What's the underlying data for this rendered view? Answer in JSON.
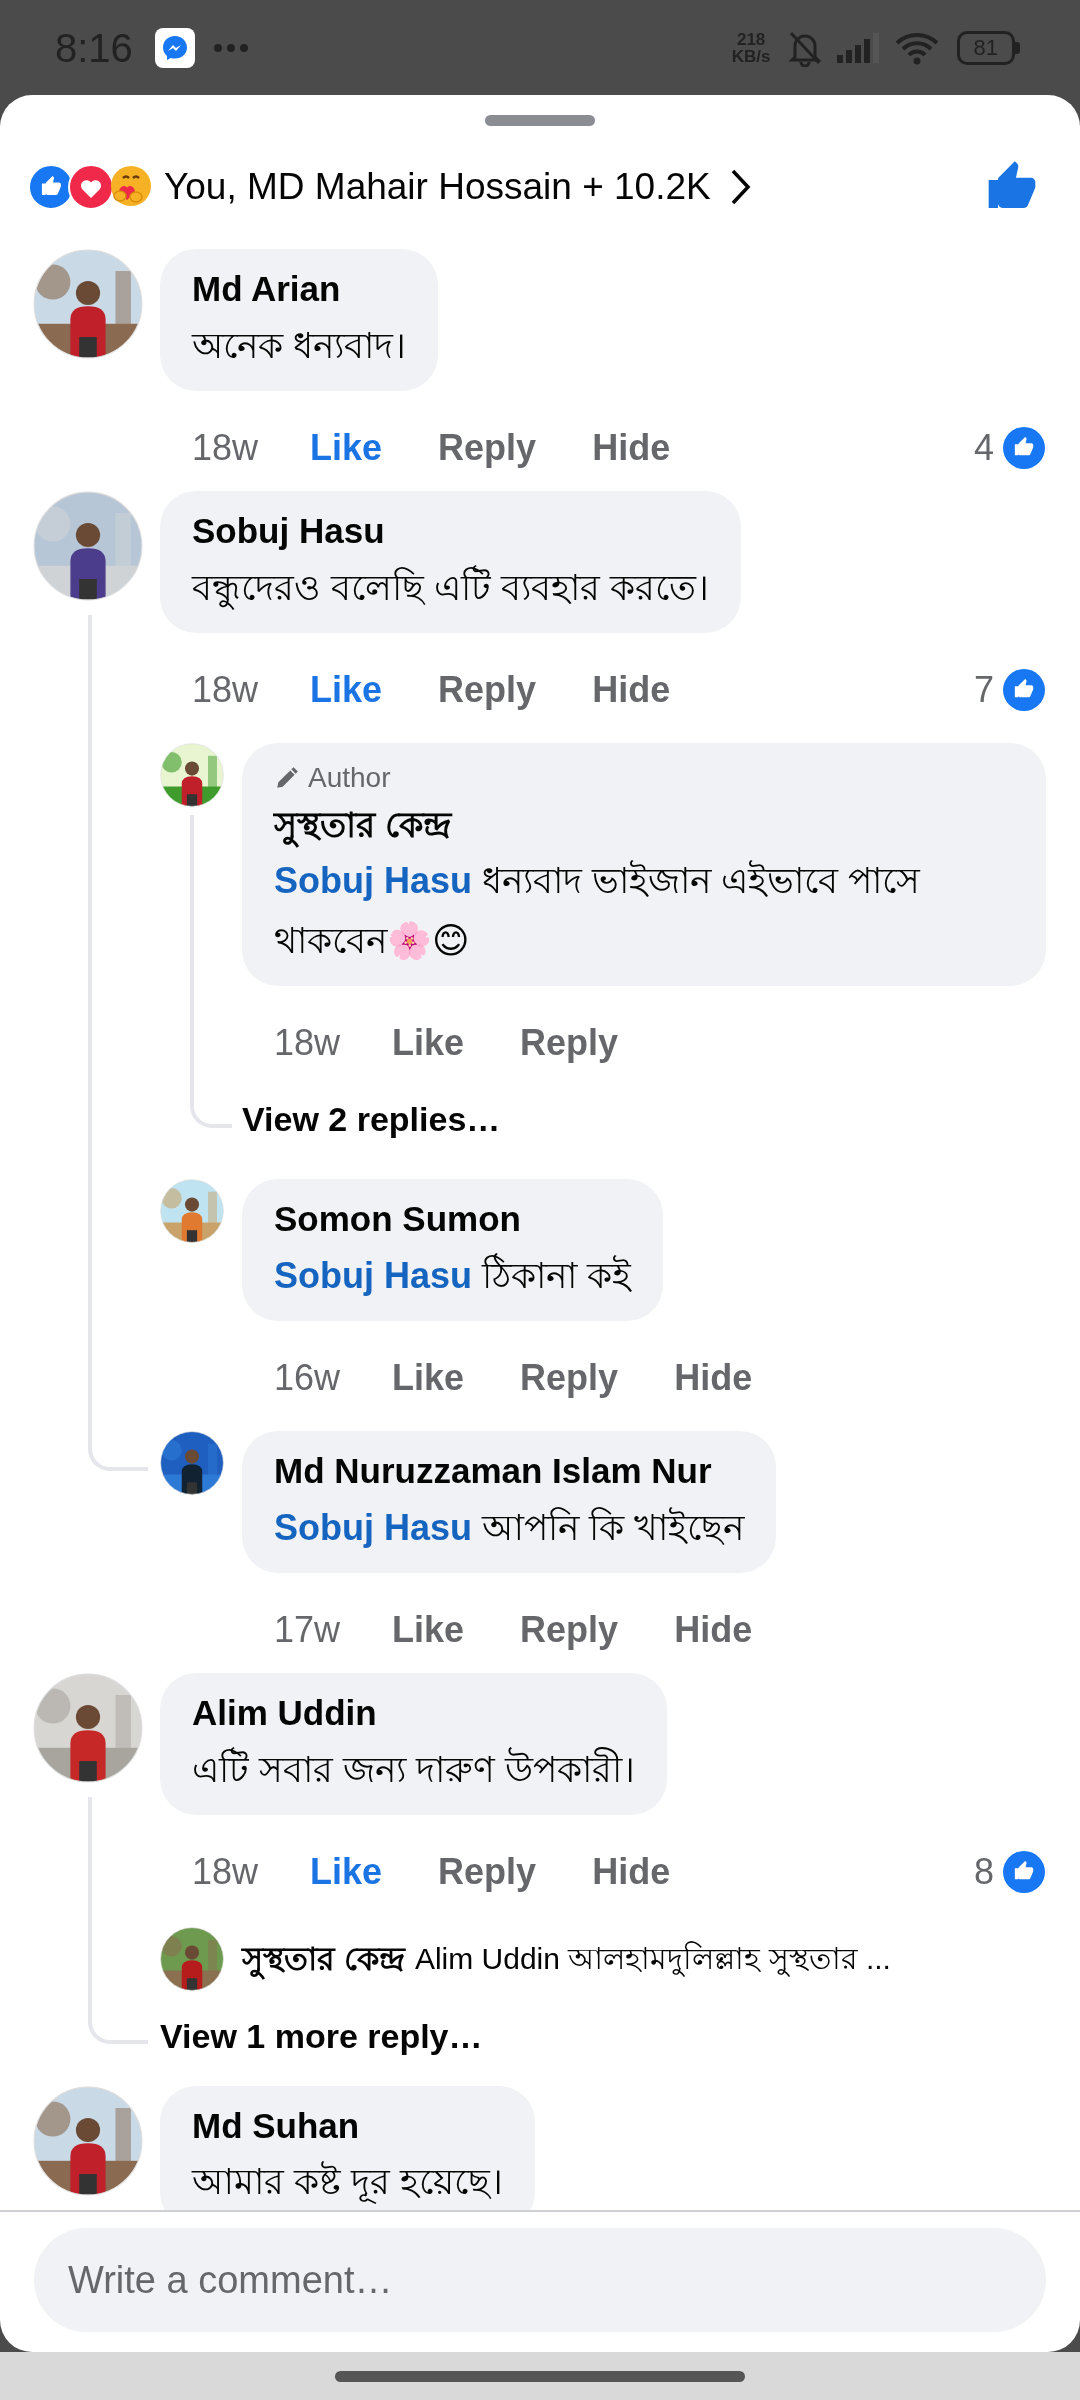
{
  "status_bar": {
    "time": "8:16",
    "speed_value": "218",
    "speed_unit": "KB/s",
    "battery": "81"
  },
  "reactions": {
    "summary": "You, MD Mahair Hossain + 10.2K",
    "liked": true
  },
  "comments": [
    {
      "author": "Md Arian",
      "text": "অনেক ধন্যবাদ।",
      "time": "18w",
      "like": "Like",
      "liked": true,
      "reply": "Reply",
      "hide": "Hide",
      "count": "4"
    },
    {
      "author": "Sobuj Hasu",
      "text": "বন্ধুদেরও বলেছি এটি ব্যবহার করতে।",
      "time": "18w",
      "like": "Like",
      "liked": true,
      "reply": "Reply",
      "hide": "Hide",
      "count": "7",
      "replies": [
        {
          "kind": "comment",
          "badge": "Author",
          "author": "সুস্থতার কেন্দ্র",
          "mention": "Sobuj Hasu",
          "text": "ধন্যবাদ ভাইজান এইভাবে পাসে থাকবেন🌸😊",
          "time": "18w",
          "like": "Like",
          "liked": false,
          "reply": "Reply",
          "more": "View 2 replies…"
        },
        {
          "kind": "comment",
          "author": "Somon Sumon",
          "mention": "Sobuj Hasu",
          "text": "ঠিকানা  কই",
          "time": "16w",
          "like": "Like",
          "liked": false,
          "reply": "Reply",
          "hide": "Hide"
        },
        {
          "kind": "comment",
          "author": "Md Nuruzzaman Islam Nur",
          "mention": "Sobuj Hasu",
          "text": "আপনি কি খাইছেন",
          "time": "17w",
          "like": "Like",
          "liked": false,
          "reply": "Reply",
          "hide": "Hide"
        }
      ]
    },
    {
      "author": "Alim Uddin",
      "text": "এটি সবার জন্য দারুণ উপকারী।",
      "time": "18w",
      "like": "Like",
      "liked": true,
      "reply": "Reply",
      "hide": "Hide",
      "count": "8",
      "replies": [
        {
          "kind": "collapsed",
          "author": "সুস্থতার কেন্দ্র",
          "text": "Alim Uddin আলহামদুলিল্লাহ সুস্থতার ..."
        }
      ],
      "more": "View 1 more reply…"
    },
    {
      "author": "Md Suhan",
      "text": "আমার কষ্ট দূর হয়েছে।"
    }
  ],
  "composer": {
    "placeholder": "Write a comment…"
  }
}
